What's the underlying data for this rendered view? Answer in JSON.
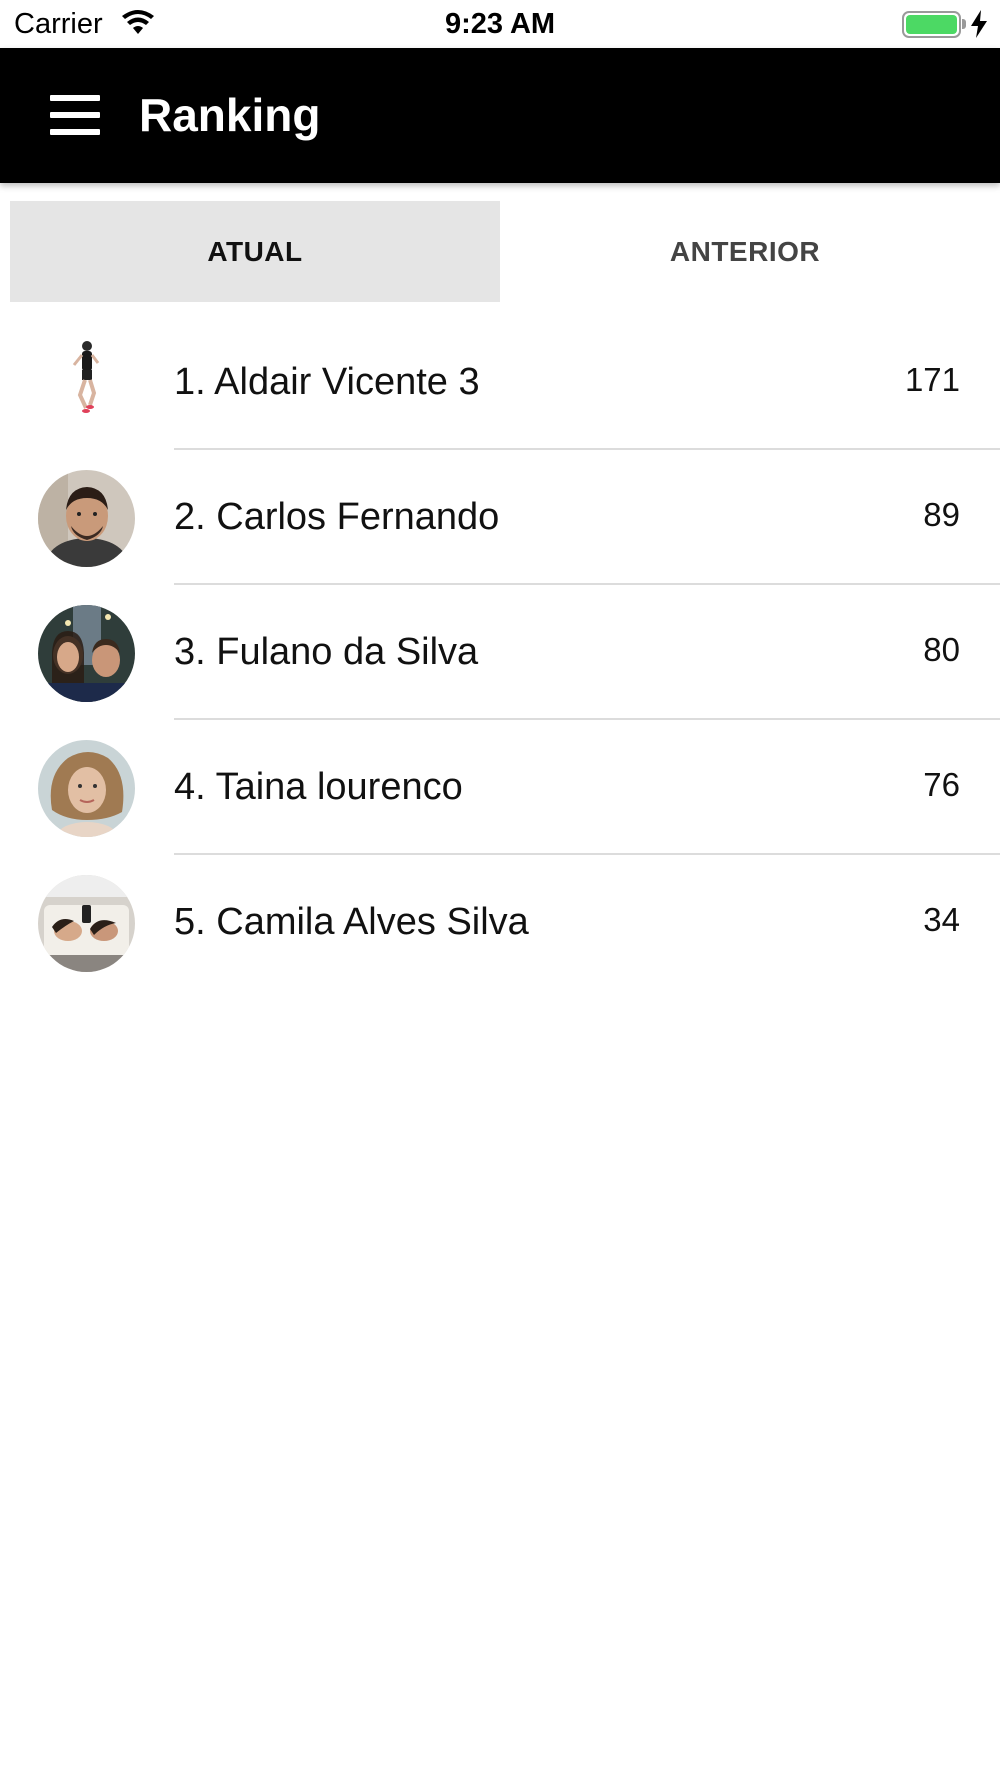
{
  "status_bar": {
    "carrier": "Carrier",
    "time": "9:23 AM",
    "battery_color": "#4cd964",
    "icons": [
      "wifi-icon",
      "battery-icon",
      "charging-bolt-icon"
    ]
  },
  "header": {
    "title": "Ranking",
    "menu_icon": "hamburger-menu-icon",
    "background": "#000000"
  },
  "tabs": [
    {
      "label": "ATUAL",
      "selected": true
    },
    {
      "label": "ANTERIOR",
      "selected": false
    }
  ],
  "ranking": [
    {
      "name": "1. Aldair Vicente 3",
      "score": "171",
      "avatar": "runner-photo"
    },
    {
      "name": "2. Carlos Fernando",
      "score": "89",
      "avatar": "man-selfie-photo"
    },
    {
      "name": "3. Fulano da Silva",
      "score": "80",
      "avatar": "couple-photo"
    },
    {
      "name": "4. Taina lourenco",
      "score": "76",
      "avatar": "woman-curly-hair-photo"
    },
    {
      "name": "5. Camila Alves Silva",
      "score": "34",
      "avatar": "mirror-selfie-photo"
    }
  ]
}
